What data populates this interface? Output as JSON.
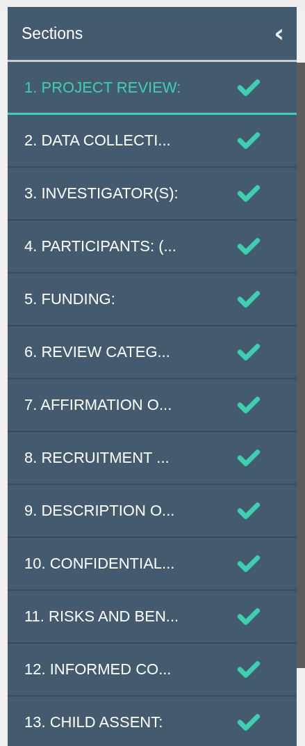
{
  "header": {
    "title": "Sections",
    "collapse_icon": "‹"
  },
  "sections": [
    {
      "label": "1. PROJECT REVIEW:",
      "selected": true,
      "completed": true
    },
    {
      "label": "2. DATA COLLECTI...",
      "selected": false,
      "completed": true
    },
    {
      "label": "3. INVESTIGATOR(S):",
      "selected": false,
      "completed": true
    },
    {
      "label": "4. PARTICIPANTS: (...",
      "selected": false,
      "completed": true
    },
    {
      "label": "5. FUNDING:",
      "selected": false,
      "completed": true
    },
    {
      "label": "6. REVIEW CATEG...",
      "selected": false,
      "completed": true
    },
    {
      "label": "7. AFFIRMATION O...",
      "selected": false,
      "completed": true
    },
    {
      "label": "8. RECRUITMENT ...",
      "selected": false,
      "completed": true
    },
    {
      "label": "9. DESCRIPTION O...",
      "selected": false,
      "completed": true
    },
    {
      "label": "10. CONFIDENTIAL...",
      "selected": false,
      "completed": true
    },
    {
      "label": "11. RISKS AND BEN...",
      "selected": false,
      "completed": true
    },
    {
      "label": "12. INFORMED CO...",
      "selected": false,
      "completed": true
    },
    {
      "label": "13. CHILD ASSENT:",
      "selected": false,
      "completed": true
    }
  ]
}
